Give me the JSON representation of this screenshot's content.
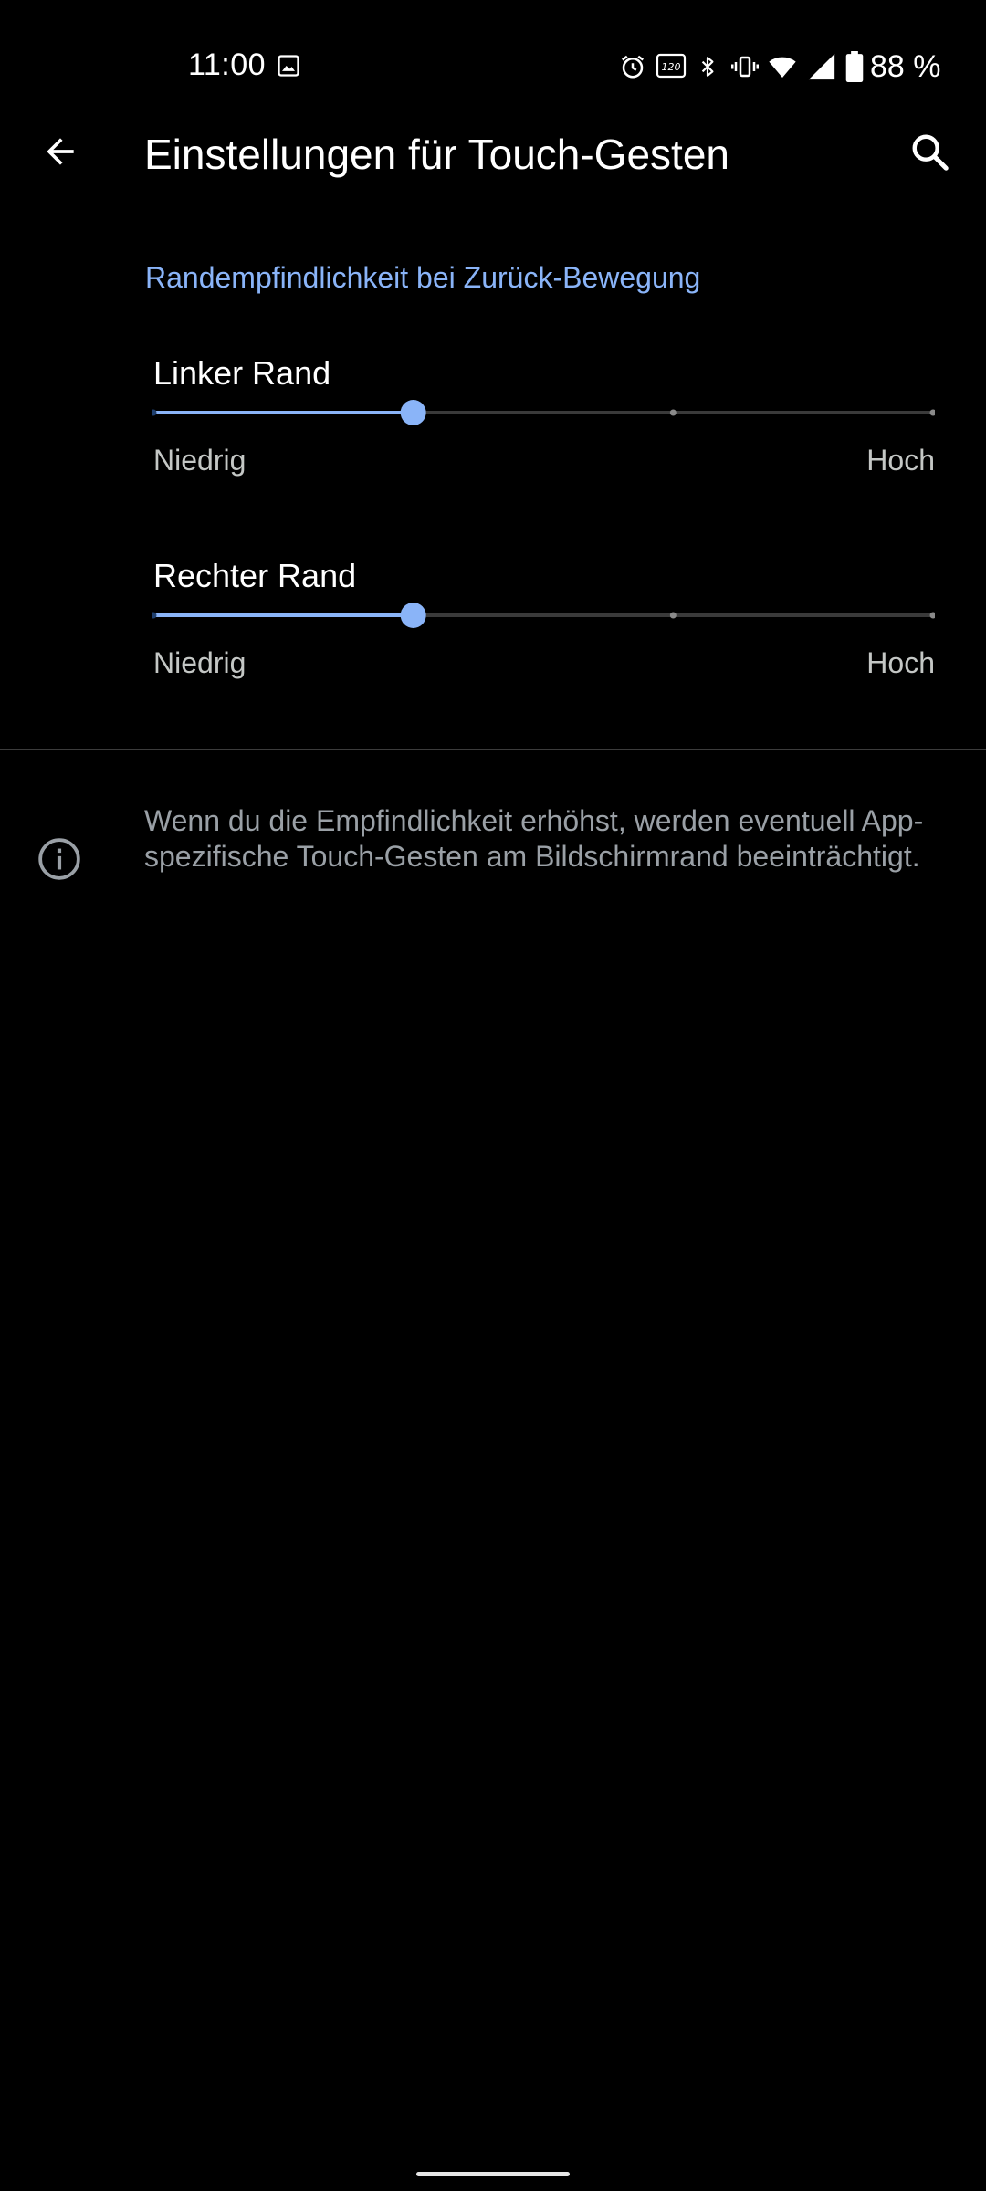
{
  "status_bar": {
    "time": "11:00",
    "battery": "88 %",
    "icons": [
      "image-icon",
      "alarm-icon",
      "refresh-rate-icon",
      "bluetooth-icon",
      "vibrate-icon",
      "wifi-icon",
      "signal-icon",
      "battery-icon"
    ],
    "refresh_rate": "120 Hz"
  },
  "app_bar": {
    "title": "Einstellungen für Touch-Gesten",
    "back_icon": "arrow-back-icon",
    "search_icon": "search-icon"
  },
  "section": {
    "header": "Randempfindlichkeit bei Zurück-Bewegung",
    "accent_color": "#8ab4f8"
  },
  "sliders": [
    {
      "label": "Linker Rand",
      "min_label": "Niedrig",
      "max_label": "Hoch",
      "steps": 4,
      "value_index": 1
    },
    {
      "label": "Rechter Rand",
      "min_label": "Niedrig",
      "max_label": "Hoch",
      "steps": 4,
      "value_index": 1
    }
  ],
  "info": {
    "icon": "info-icon",
    "text": "Wenn du die Empfindlichkeit erhöhst, werden eventuell App-spezifische Touch-Gesten am Bildschirmrand beeinträchtigt."
  }
}
